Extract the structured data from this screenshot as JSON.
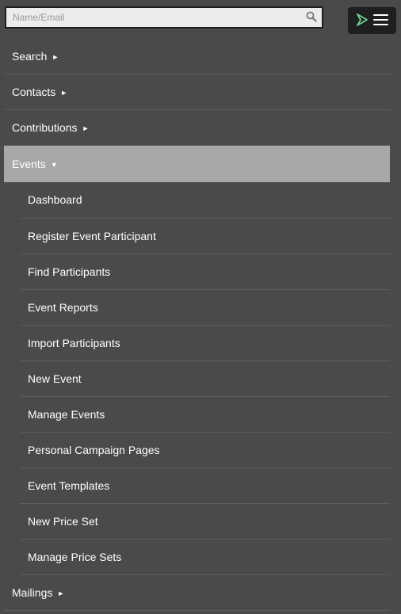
{
  "search": {
    "placeholder": "Name/Email"
  },
  "menu_button": {
    "logo_icon": "civicrm-logo-icon",
    "hamburger_icon": "hamburger-icon"
  },
  "nav": {
    "items": [
      {
        "label": "Search",
        "arrow": "►"
      },
      {
        "label": "Contacts",
        "arrow": "►"
      },
      {
        "label": "Contributions",
        "arrow": "►"
      },
      {
        "label": "Events",
        "arrow": "▼",
        "active": true
      },
      {
        "label": "Mailings",
        "arrow": "►"
      }
    ],
    "events_submenu": [
      "Dashboard",
      "Register Event Participant",
      "Find Participants",
      "Event Reports",
      "Import Participants",
      "New Event",
      "Manage Events",
      "Personal Campaign Pages",
      "Event Templates",
      "New Price Set",
      "Manage Price Sets"
    ]
  },
  "colors": {
    "background": "#4a4a49",
    "active_item": "#a8a8a8",
    "divider": "#5c5c5b",
    "logo_accent": "#6ed38b"
  }
}
